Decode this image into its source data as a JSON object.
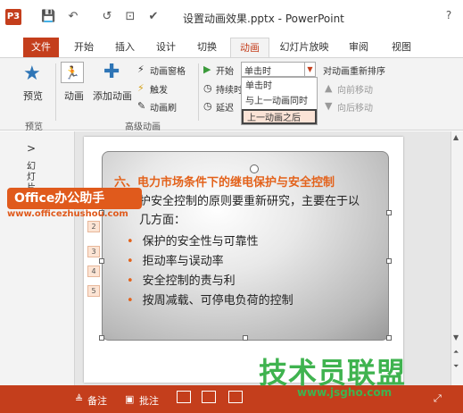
{
  "app": {
    "logo_text": "P3",
    "title": "设置动画效果.pptx - PowerPoint",
    "help": "?"
  },
  "quick_access": {
    "save": "💾",
    "undo": "↶",
    "redo": "↺",
    "present": "⊡",
    "touch": "✔"
  },
  "tabs": [
    "文件",
    "开始",
    "插入",
    "设计",
    "切换",
    "动画",
    "幻灯片放映",
    "审阅",
    "视图"
  ],
  "ribbon": {
    "preview": "预览",
    "preview_group": "预览",
    "animation": "动画",
    "add_animation": "添加动画",
    "animation_pane": "动画窗格",
    "trigger": "触发",
    "animation_painter": "动画刷",
    "advanced_group": "高级动画",
    "start_label": "开始",
    "start_value": "单击时",
    "duration_label": "持续时",
    "delay_label": "延迟",
    "reorder": "对动画重新排序",
    "move_earlier": "向前移动",
    "move_later": "向后移动",
    "dropdown_options": [
      "单击时",
      "与上一动画同时",
      "上一动画之后"
    ]
  },
  "left_pane": {
    "collapse": ">",
    "label": "幻灯片"
  },
  "slide": {
    "title": "六、电力市场条件下的继电保护与安全控制",
    "line1": "护安全控制的原则要重新研究，主要在于以",
    "line2": "几方面：",
    "bullets": [
      "保护的安全性与可靠性",
      "拒动率与误动率",
      "安全控制的责与利",
      "按周减载、可停电负荷的控制"
    ],
    "anim_tags": [
      "2",
      "3",
      "4",
      "5"
    ]
  },
  "watermark": {
    "office_badge": "Office办公助手",
    "office_url": "www.officezhushou.com",
    "jsgho_logo": "技术员联盟",
    "jsgho_url": "www.jsgho.com"
  },
  "status": {
    "notes": "备注",
    "comments": "批注"
  }
}
